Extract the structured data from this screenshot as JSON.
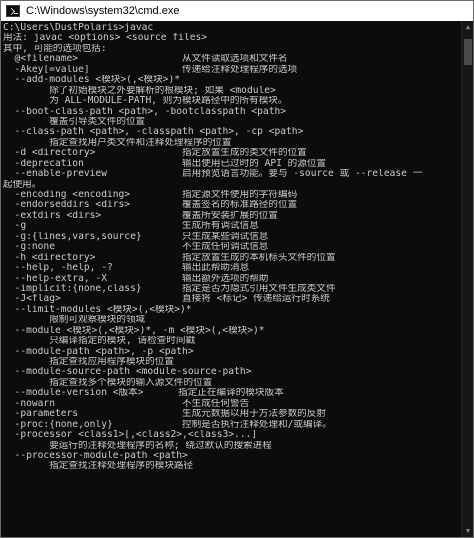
{
  "window": {
    "title": "C:\\Windows\\system32\\cmd.exe",
    "app_icon": "terminal-icon"
  },
  "console": {
    "lines": [
      "C:\\Users\\DustPolaris>javac",
      "用法: javac <options> <source files>",
      "其中, 可能的选项包括:",
      "  @<filename>                  从文件读取选项和文件名",
      "  -Akey[=value]                传递给注释处理程序的选项",
      "  --add-modules <模块>(,<模块>)*",
      "        除了初始模块之外要解析的根模块; 如果 <module>",
      "        为 ALL-MODULE-PATH, 则为模块路径中的所有模块。",
      "  --boot-class-path <path>, -bootclasspath <path>",
      "        覆盖引导类文件的位置",
      "  --class-path <path>, -classpath <path>, -cp <path>",
      "        指定查找用户类文件和注释处理程序的位置",
      "  -d <directory>               指定放置生成的类文件的位置",
      "  -deprecation                 输出使用已过时的 API 的源位置",
      "  --enable-preview             启用预览语言功能。要与 -source 或 --release 一",
      "起使用。",
      "  -encoding <encoding>         指定源文件使用的字符编码",
      "  -endorseddirs <dirs>         覆盖签名的标准路径的位置",
      "  -extdirs <dirs>              覆盖所安装扩展的位置",
      "  -g                           生成所有调试信息",
      "  -g:{lines,vars,source}       只生成某些调试信息",
      "  -g:none                      不生成任何调试信息",
      "  -h <directory>               指定放置生成的本机标头文件的位置",
      "  --help, -help, -?            输出此帮助消息",
      "  --help-extra, -X             输出额外选项的帮助",
      "  -implicit:{none,class}       指定是否为隐式引用文件生成类文件",
      "  -J<flag>                     直接将 <标记> 传递给运行时系统",
      "  --limit-modules <模块>(,<模块>)*",
      "        限制可观察模块的领域",
      "  --module <模块>(,<模块>)*, -m <模块>(,<模块>)*",
      "        只编译指定的模块, 请检查时间戳",
      "  --module-path <path>, -p <path>",
      "        指定查找应用程序模块的位置",
      "  --module-source-path <module-source-path>",
      "        指定查找多个模块的输入源文件的位置",
      "  --module-version <版本>      指定正在编译的模块版本",
      "  -nowarn                      不生成任何警告",
      "  -parameters                  生成元数据以用于方法参数的反射",
      "  -proc:{none,only}            控制是否执行注释处理和/或编译。",
      "  -processor <class1>[,<class2>,<class3>...]",
      "        要运行的注释处理程序的名称; 绕过默认的搜索进程",
      "  --processor-module-path <path>",
      "        指定查找注释处理程序的模块路径"
    ]
  },
  "scrollbar": {
    "up_icon": "scroll-up-arrow-icon",
    "down_icon": "scroll-down-arrow-icon"
  }
}
